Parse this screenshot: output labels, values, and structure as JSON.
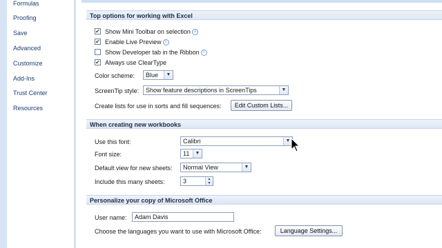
{
  "nav": {
    "items": [
      "Formulas",
      "Proofing",
      "Save",
      "Advanced",
      "Customize",
      "Add-Ins",
      "Trust Center",
      "Resources"
    ]
  },
  "sections": {
    "top_options": "Top options for working with Excel",
    "new_workbooks": "When creating new workbooks",
    "personalize": "Personalize your copy of Microsoft Office"
  },
  "top_options": {
    "mini_toolbar": {
      "label": "Show Mini Toolbar on selection",
      "checked": true
    },
    "live_preview": {
      "label": "Enable Live Preview",
      "checked": true
    },
    "developer_tab": {
      "label": "Show Developer tab in the Ribbon",
      "checked": false
    },
    "cleartype": {
      "label": "Always use ClearType",
      "checked": true
    },
    "color_scheme_label": "Color scheme:",
    "color_scheme_value": "Blue",
    "screentip_label": "ScreenTip style:",
    "screentip_value": "Show feature descriptions in ScreenTips",
    "custom_lists_label": "Create lists for use in sorts and fill sequences:",
    "edit_custom_lists_button": "Edit Custom Lists..."
  },
  "new_workbooks": {
    "font_label": "Use this font:",
    "font_value": "Calibri",
    "font_size_label": "Font size:",
    "font_size_value": "11",
    "default_view_label": "Default view for new sheets:",
    "default_view_value": "Normal View",
    "sheets_label": "Include this many sheets:",
    "sheets_value": "3"
  },
  "personalize": {
    "user_name_label": "User name:",
    "user_name_value": "Adam Davis",
    "languages_label": "Choose the languages you want to use with Microsoft Office:",
    "language_settings_button": "Language Settings..."
  },
  "icons": {
    "info": "info-icon",
    "dropdown": "chevron-down-icon",
    "spin": "spinner-arrows-icon",
    "check": "checkmark-icon",
    "pointer": "mouse-cursor-icon"
  }
}
